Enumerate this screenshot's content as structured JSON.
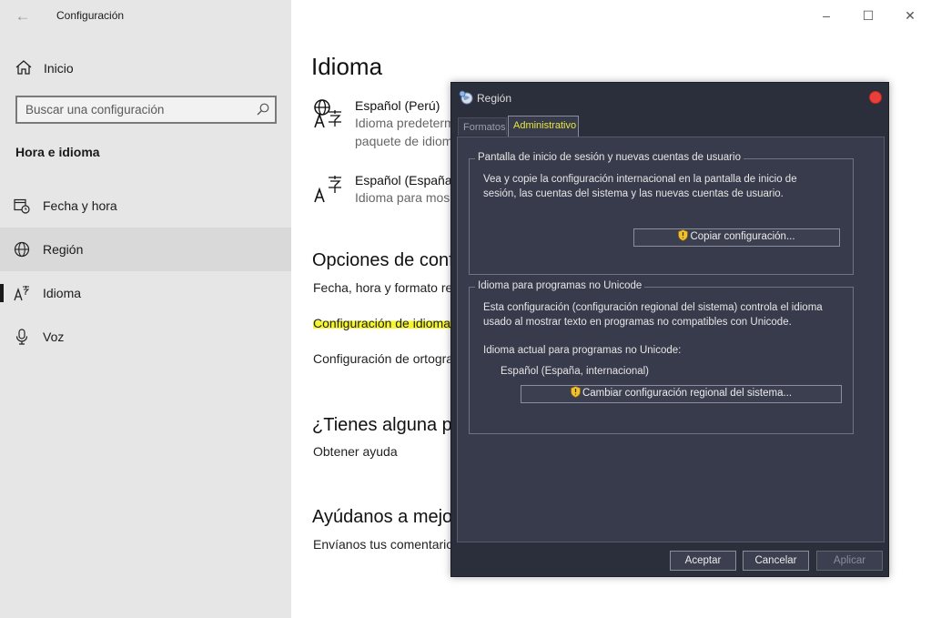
{
  "settings": {
    "app_title": "Configuración",
    "home_label": "Inicio",
    "search_placeholder": "Buscar una configuración",
    "section_title": "Hora e idioma",
    "nav": [
      {
        "label": "Fecha y hora",
        "icon": "calendar-clock-icon"
      },
      {
        "label": "Región",
        "icon": "globe-icon"
      },
      {
        "label": "Idioma",
        "icon": "language-icon"
      },
      {
        "label": "Voz",
        "icon": "microphone-icon"
      }
    ],
    "active_nav": "Región"
  },
  "main": {
    "title": "Idioma",
    "languages": [
      {
        "name": "Español (Perú)",
        "desc1": "Idioma predeterm",
        "desc2": "paquete de idiom"
      },
      {
        "name": "Español (España)",
        "desc1": "Idioma para mos"
      }
    ],
    "options_heading": "Opciones de conf",
    "links": [
      "Fecha, hora y formato re",
      "Configuración de idioma",
      "Configuración de ortogra"
    ],
    "help_heading": "¿Tienes alguna pr",
    "help_link": "Obtener ayuda",
    "improve_heading": "Ayúdanos a mejo",
    "improve_link": "Envíanos tus comentario"
  },
  "dialog": {
    "title": "Región",
    "tabs": [
      "Formatos",
      "Administrativo"
    ],
    "active_tab": "Administrativo",
    "group1": {
      "title": "Pantalla de inicio de sesión y nuevas cuentas de usuario",
      "line1": "Vea y copie la configuración internacional en la pantalla de inicio de",
      "line2": "sesión, las cuentas del sistema y las nuevas cuentas de usuario.",
      "button": "Copiar configuración..."
    },
    "group2": {
      "title": "Idioma para programas no Unicode",
      "line1": "Esta configuración (configuración regional del sistema) controla el idioma",
      "line2": "usado al mostrar texto en programas no compatibles con Unicode.",
      "current_label": "Idioma actual para programas no Unicode:",
      "current_value": "Español (España, internacional)",
      "button": "Cambiar configuración regional del sistema..."
    },
    "buttons": {
      "ok": "Aceptar",
      "cancel": "Cancelar",
      "apply": "Aplicar"
    },
    "colors": {
      "background": "#2b2e3b",
      "panel": "#383b4b",
      "tab_active_text": "#e7e73a",
      "close": "#e8413c"
    }
  },
  "highlight_color": "#f6f62e"
}
